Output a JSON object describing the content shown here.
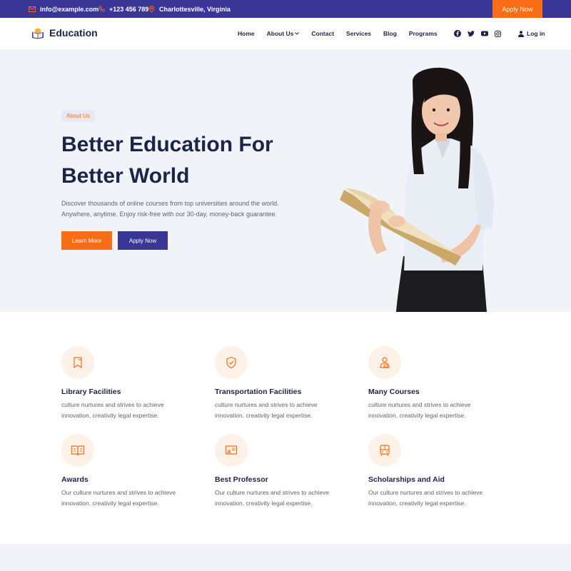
{
  "topbar": {
    "email": "info@example.com",
    "phone": "+123 456 789",
    "location": "Charlottesville, Virginia",
    "apply_label": "Apply Now"
  },
  "nav": {
    "logo_text": "Education",
    "menu": [
      "Home",
      "About Us",
      "Contact",
      "Services",
      "Blog",
      "Programs"
    ],
    "socials": [
      "facebook-icon",
      "twitter-icon",
      "youtube-icon",
      "instagram-icon"
    ],
    "login_label": "Log in"
  },
  "hero": {
    "badge": "About Us",
    "title_line1": "Better Education For",
    "title_line2": "Better World",
    "desc_line1": "Discover thousands of online courses from top universities around the world.",
    "desc_line2": "Anywhere, anytime. Enjoy risk-free with our 30-day, money-back guarantee.",
    "primary_button": "Learn More",
    "secondary_button": "Apply Now"
  },
  "features": [
    {
      "title": "Library Facilities",
      "desc_line1": "culture nurtures and strives to achieve",
      "desc_line2": "innovation, creativity legal expertise.",
      "icon": "bookmark-icon"
    },
    {
      "title": "Transportation Facilities",
      "desc_line1": "culture nurtures and strives to achieve",
      "desc_line2": "innovation, creativity legal expertise.",
      "icon": "shield-check-icon"
    },
    {
      "title": "Many Courses",
      "desc_line1": "culture nurtures and strives to achieve",
      "desc_line2": "innovation, creativity legal expertise.",
      "icon": "student-icon"
    },
    {
      "title": "Awards",
      "desc_line1": "Our culture nurtures and strives to achieve",
      "desc_line2": "innovation, creativity legal expertise.",
      "icon": "open-book-icon"
    },
    {
      "title": "Best Professor",
      "desc_line1": "Our culture nurtures and strives to achieve",
      "desc_line2": "innovation, creativity legal expertise.",
      "icon": "presentation-icon"
    },
    {
      "title": "Scholarships and Aid",
      "desc_line1": "Our culture nurtures and strives to achieve",
      "desc_line2": "innovation, creativity legal expertise.",
      "icon": "bus-icon"
    }
  ],
  "colors": {
    "primary": "#3a3696",
    "accent": "#f96d17",
    "heading": "#1d2547",
    "hero_bg": "#f0f3f8",
    "icon_bg": "#fef1e8"
  }
}
